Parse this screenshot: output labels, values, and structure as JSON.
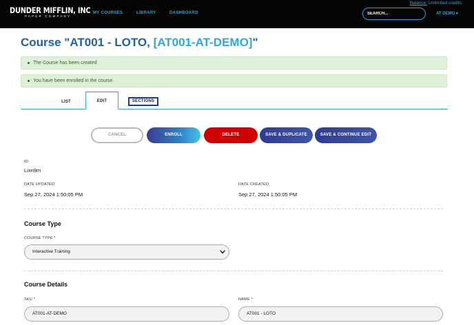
{
  "brand": {
    "name": "DUNDER MIFFLIN, INC",
    "tagline": "PAPER COMPANY"
  },
  "nav": {
    "items": [
      "MY COURSES",
      "LIBRARY",
      "DASHBOARD"
    ],
    "balance_link": "Balance:",
    "balance_value": "Unlimited credits",
    "search_placeholder": "SEARCH...",
    "user_menu": "AT DEMO ▾"
  },
  "page": {
    "title_prefix": "Course \"AT001 - LOTO, ",
    "title_sku": "[AT001-AT-DEMO]",
    "title_suffix": "\""
  },
  "alerts": [
    "The Course has been created",
    "You have been enrolled in the course."
  ],
  "tabs": {
    "list": "LIST",
    "edit": "EDIT",
    "sections": "SECTIONS"
  },
  "actions": {
    "cancel": "CANCEL",
    "enroll": "ENROLL",
    "delete": "DELETE",
    "save_duplicate": "SAVE & DUPLICATE",
    "save_continue": "SAVE & CONTINUE EDIT"
  },
  "meta": {
    "id_label": "ID:",
    "id_value": "Lixn9m",
    "updated_label": "DATE UPDATED:",
    "updated_value": "Sep 27, 2024 1:50:05 PM",
    "created_label": "DATE CREATED:",
    "created_value": "Sep 27, 2024 1:50:05 PM"
  },
  "course_type": {
    "section_title": "Course Type",
    "label": "COURSE TYPE *",
    "selected": "Interactive Training"
  },
  "course_details": {
    "section_title": "Course Details",
    "sku_label": "SKU *",
    "sku_value": "AT001-AT-DEMO",
    "name_label": "NAME *",
    "name_value": "AT001 - LOTO"
  },
  "colors": {
    "accent": "#2ea6de",
    "title": "#1f5fa3",
    "danger": "#d10000",
    "success_bg": "#dff0d8"
  }
}
